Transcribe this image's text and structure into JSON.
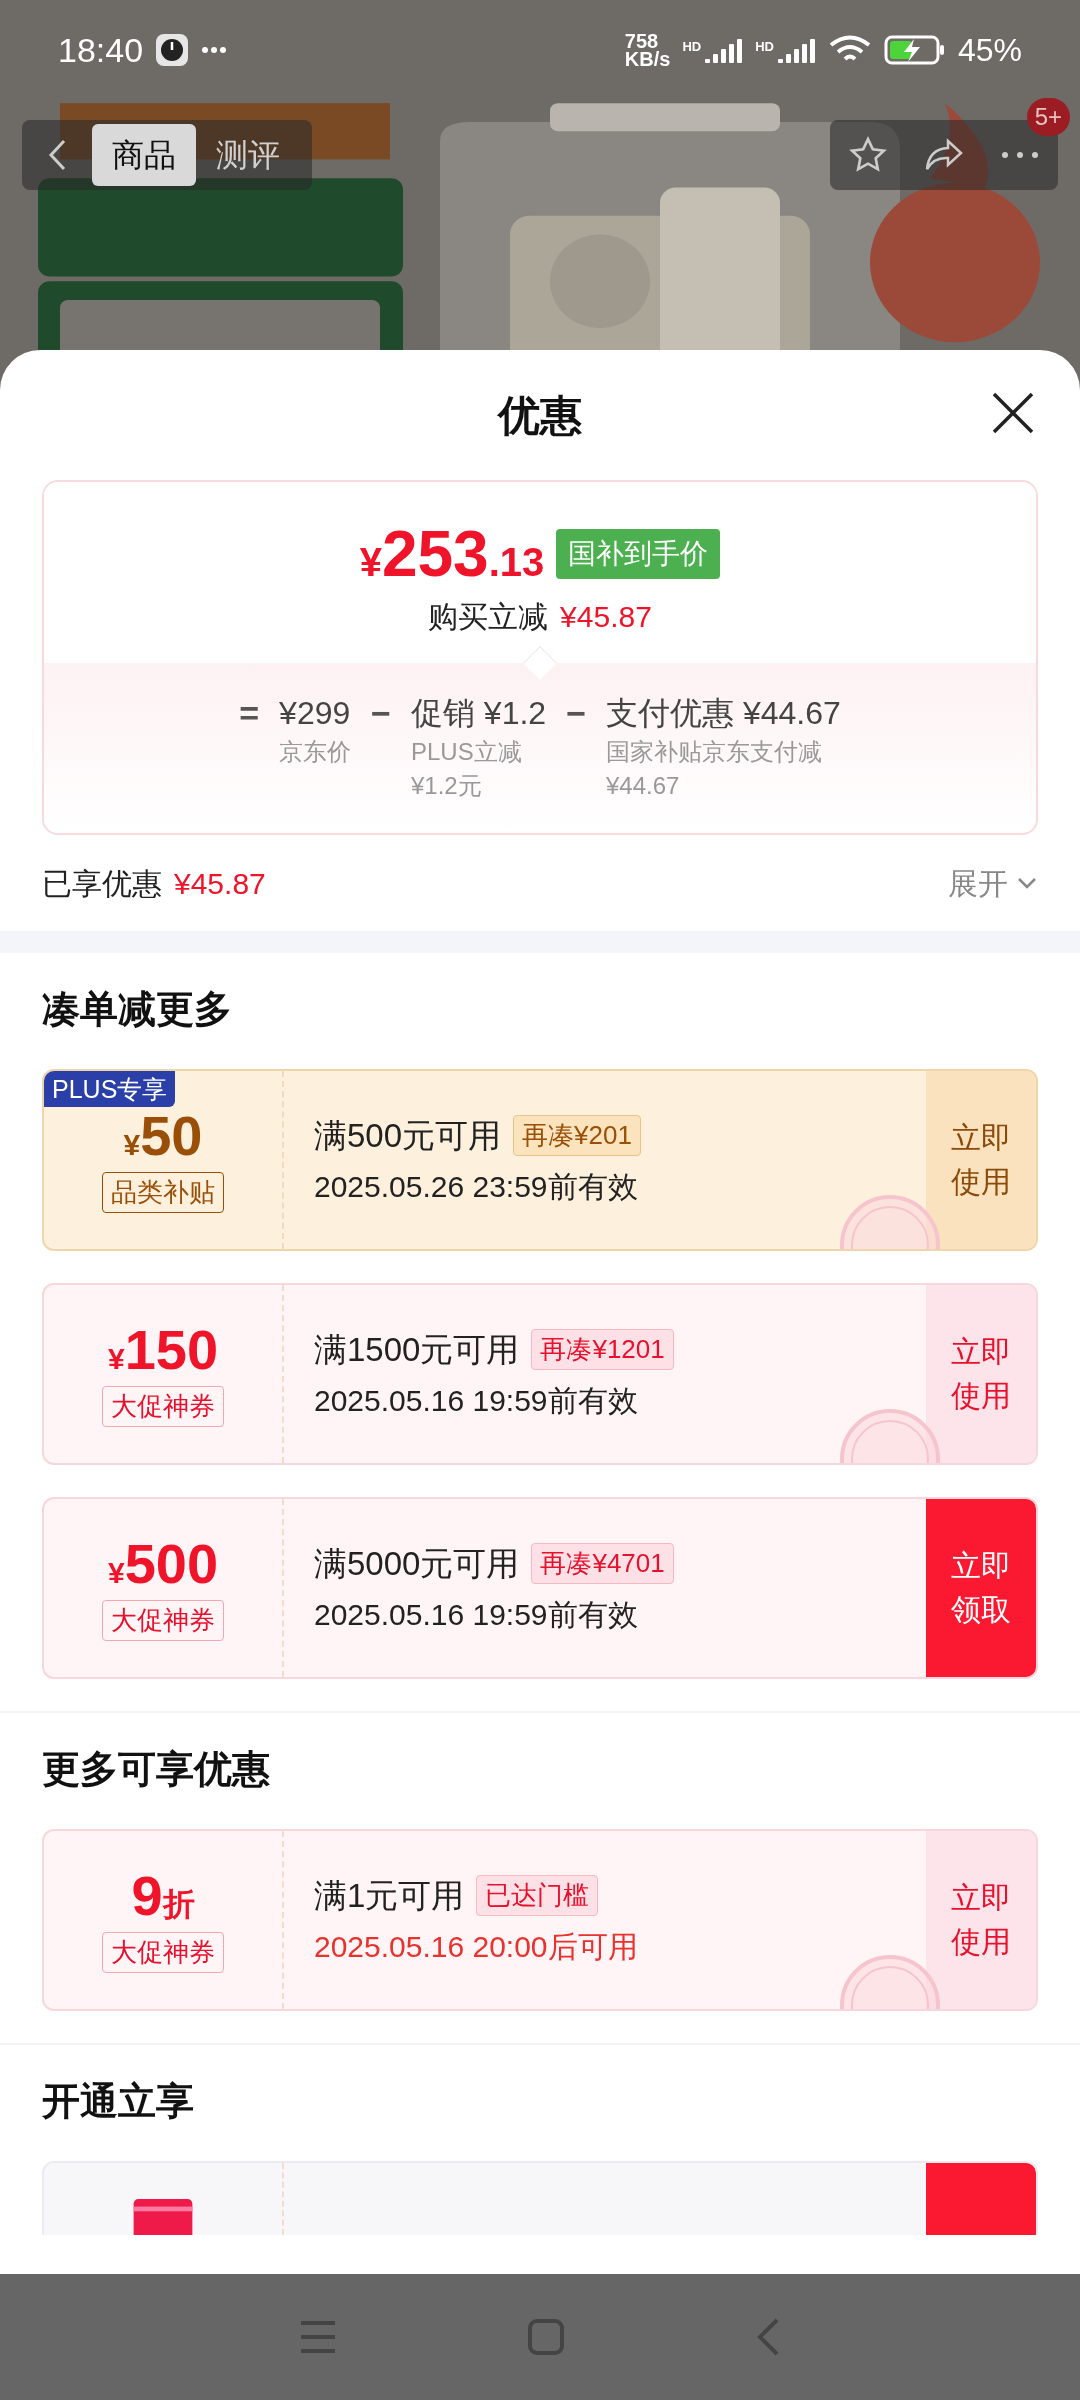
{
  "status_bar": {
    "time": "18:40",
    "speed_value": "758",
    "speed_unit": "KB/s",
    "sim_labels": [
      "HD",
      "HD"
    ],
    "battery": "45%"
  },
  "header": {
    "tabs": [
      {
        "label": "商品",
        "selected": true
      },
      {
        "label": "测评",
        "selected": false
      }
    ],
    "badge": "5+"
  },
  "sheet": {
    "title": "优惠"
  },
  "price_card": {
    "currency": "¥",
    "price_int": "253",
    "price_dec": ".13",
    "tag": "国补到手价",
    "subtitle": "购买立减",
    "subtitle_amount": "¥45.87",
    "formula": [
      {
        "op": "=",
        "value": "¥299",
        "notes": [
          "京东价"
        ]
      },
      {
        "op": "−",
        "value": "促销 ¥1.2",
        "notes": [
          "PLUS立减",
          "¥1.2元"
        ]
      },
      {
        "op": "−",
        "value": "支付优惠 ¥44.67",
        "notes": [
          "国家补贴京东支付减",
          "¥44.67"
        ]
      }
    ]
  },
  "enjoyed": {
    "label": "已享优惠",
    "amount": "¥45.87",
    "expand": "展开"
  },
  "sections": [
    {
      "title": "凑单减更多",
      "coupons": [
        {
          "kind": "amount",
          "color": "#fdf0dc",
          "corner_tag": "PLUS专享",
          "symbol": "¥",
          "value": "50",
          "label": "品类补贴",
          "condition": "满500元可用",
          "hint": "再凑¥201",
          "validity": "2025.05.26 23:59前有效",
          "validity_alert": false,
          "action": "立即使用",
          "action_primary": false,
          "claimed": true
        },
        {
          "kind": "amount",
          "color": "#fff4f6",
          "symbol": "¥",
          "value": "150",
          "label": "大促神券",
          "condition": "满1500元可用",
          "hint": "再凑¥1201",
          "validity": "2025.05.16 19:59前有效",
          "validity_alert": false,
          "action": "立即使用",
          "action_primary": false,
          "claimed": true
        },
        {
          "kind": "amount",
          "color": "#fff4f6",
          "symbol": "¥",
          "value": "500",
          "label": "大促神券",
          "condition": "满5000元可用",
          "hint": "再凑¥4701",
          "validity": "2025.05.16 19:59前有效",
          "validity_alert": false,
          "action": "立即领取",
          "action_primary": true,
          "claimed": false
        }
      ]
    },
    {
      "title": "更多可享优惠",
      "coupons": [
        {
          "kind": "discount",
          "color": "#fff4f6",
          "value": "9",
          "unit": "折",
          "label": "大促神券",
          "condition": "满1元可用",
          "hint": "已达门槛",
          "validity": "2025.05.16 20:00后可用",
          "validity_alert": true,
          "action": "立即使用",
          "action_primary": false,
          "claimed": true
        }
      ]
    },
    {
      "title": "开通立享",
      "coupons": [
        {
          "kind": "membership",
          "color": "#f7f7fa",
          "action_primary": true
        }
      ]
    }
  ]
}
